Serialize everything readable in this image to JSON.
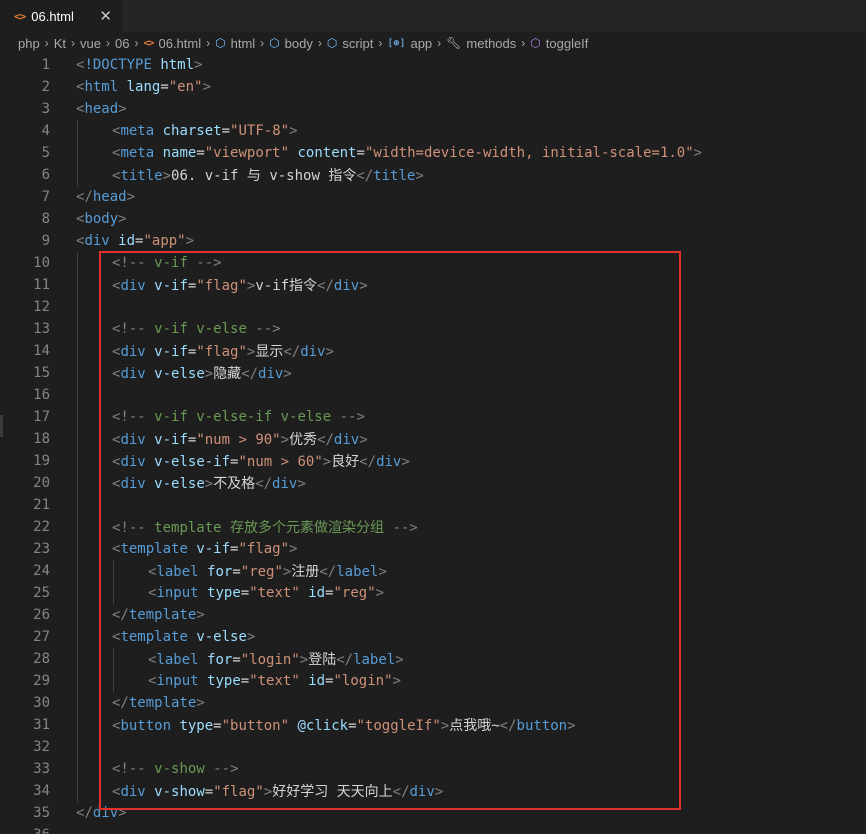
{
  "tab": {
    "icon": "<>",
    "label": "06.html",
    "close": "✕"
  },
  "breadcrumb": [
    {
      "label": "php",
      "icon": ""
    },
    {
      "label": "Kt",
      "icon": ""
    },
    {
      "label": "vue",
      "icon": ""
    },
    {
      "label": "06",
      "icon": ""
    },
    {
      "label": "06.html",
      "icon": "html-file-icon"
    },
    {
      "label": "html",
      "icon": "element-icon"
    },
    {
      "label": "body",
      "icon": "element-icon"
    },
    {
      "label": "script",
      "icon": "element-icon"
    },
    {
      "label": "app",
      "icon": "variable-icon"
    },
    {
      "label": "methods",
      "icon": "wrench-icon"
    },
    {
      "label": "toggleIf",
      "icon": "method-icon"
    }
  ],
  "lines": [
    {
      "n": "1",
      "indent": 0,
      "tokens": [
        [
          "t",
          "<"
        ],
        [
          "tag",
          "!DOCTYPE"
        ],
        [
          "t",
          " "
        ],
        [
          "attr",
          "html"
        ],
        [
          "t",
          ">"
        ]
      ]
    },
    {
      "n": "2",
      "indent": 0,
      "tokens": [
        [
          "t",
          "<"
        ],
        [
          "tag",
          "html"
        ],
        [
          "t",
          " "
        ],
        [
          "attr",
          "lang"
        ],
        [
          "txt",
          "="
        ],
        [
          "val",
          "\"en\""
        ],
        [
          "t",
          ">"
        ]
      ]
    },
    {
      "n": "3",
      "indent": 0,
      "tokens": [
        [
          "t",
          "<"
        ],
        [
          "tag",
          "head"
        ],
        [
          "t",
          ">"
        ]
      ]
    },
    {
      "n": "4",
      "indent": 1,
      "tokens": [
        [
          "t",
          "<"
        ],
        [
          "tag",
          "meta"
        ],
        [
          "t",
          " "
        ],
        [
          "attr",
          "charset"
        ],
        [
          "txt",
          "="
        ],
        [
          "val",
          "\"UTF-8\""
        ],
        [
          "t",
          ">"
        ]
      ]
    },
    {
      "n": "5",
      "indent": 1,
      "tokens": [
        [
          "t",
          "<"
        ],
        [
          "tag",
          "meta"
        ],
        [
          "t",
          " "
        ],
        [
          "attr",
          "name"
        ],
        [
          "txt",
          "="
        ],
        [
          "val",
          "\"viewport\""
        ],
        [
          "t",
          " "
        ],
        [
          "attr",
          "content"
        ],
        [
          "txt",
          "="
        ],
        [
          "val",
          "\"width=device-width, initial-scale=1.0\""
        ],
        [
          "t",
          ">"
        ]
      ]
    },
    {
      "n": "6",
      "indent": 1,
      "tokens": [
        [
          "t",
          "<"
        ],
        [
          "tag",
          "title"
        ],
        [
          "t",
          ">"
        ],
        [
          "txt",
          "06. v-if 与 v-show 指令"
        ],
        [
          "t",
          "</"
        ],
        [
          "tag",
          "title"
        ],
        [
          "t",
          ">"
        ]
      ]
    },
    {
      "n": "7",
      "indent": 0,
      "tokens": [
        [
          "t",
          "</"
        ],
        [
          "tag",
          "head"
        ],
        [
          "t",
          ">"
        ]
      ]
    },
    {
      "n": "8",
      "indent": 0,
      "tokens": [
        [
          "t",
          "<"
        ],
        [
          "tag",
          "body"
        ],
        [
          "t",
          ">"
        ]
      ]
    },
    {
      "n": "9",
      "indent": 0,
      "tokens": [
        [
          "t",
          "<"
        ],
        [
          "tag",
          "div"
        ],
        [
          "t",
          " "
        ],
        [
          "attr",
          "id"
        ],
        [
          "txt",
          "="
        ],
        [
          "val",
          "\"app\""
        ],
        [
          "t",
          ">"
        ]
      ]
    },
    {
      "n": "10",
      "indent": 1,
      "tokens": [
        [
          "t",
          "<!-- "
        ],
        [
          "cmt",
          "v-if"
        ],
        [
          "t",
          " -->"
        ]
      ]
    },
    {
      "n": "11",
      "indent": 1,
      "tokens": [
        [
          "t",
          "<"
        ],
        [
          "tag",
          "div"
        ],
        [
          "t",
          " "
        ],
        [
          "attr",
          "v-if"
        ],
        [
          "txt",
          "="
        ],
        [
          "val",
          "\"flag\""
        ],
        [
          "t",
          ">"
        ],
        [
          "txt",
          "v-if指令"
        ],
        [
          "t",
          "</"
        ],
        [
          "tag",
          "div"
        ],
        [
          "t",
          ">"
        ]
      ]
    },
    {
      "n": "12",
      "indent": 1,
      "tokens": []
    },
    {
      "n": "13",
      "indent": 1,
      "tokens": [
        [
          "t",
          "<!-- "
        ],
        [
          "cmt",
          "v-if v-else"
        ],
        [
          "t",
          " -->"
        ]
      ]
    },
    {
      "n": "14",
      "indent": 1,
      "tokens": [
        [
          "t",
          "<"
        ],
        [
          "tag",
          "div"
        ],
        [
          "t",
          " "
        ],
        [
          "attr",
          "v-if"
        ],
        [
          "txt",
          "="
        ],
        [
          "val",
          "\"flag\""
        ],
        [
          "t",
          ">"
        ],
        [
          "txt",
          "显示"
        ],
        [
          "t",
          "</"
        ],
        [
          "tag",
          "div"
        ],
        [
          "t",
          ">"
        ]
      ]
    },
    {
      "n": "15",
      "indent": 1,
      "tokens": [
        [
          "t",
          "<"
        ],
        [
          "tag",
          "div"
        ],
        [
          "t",
          " "
        ],
        [
          "attr",
          "v-else"
        ],
        [
          "t",
          ">"
        ],
        [
          "txt",
          "隐藏"
        ],
        [
          "t",
          "</"
        ],
        [
          "tag",
          "div"
        ],
        [
          "t",
          ">"
        ]
      ]
    },
    {
      "n": "16",
      "indent": 1,
      "tokens": []
    },
    {
      "n": "17",
      "indent": 1,
      "tokens": [
        [
          "t",
          "<!-- "
        ],
        [
          "cmt",
          "v-if v-else-if v-else"
        ],
        [
          "t",
          " -->"
        ]
      ]
    },
    {
      "n": "18",
      "indent": 1,
      "tokens": [
        [
          "t",
          "<"
        ],
        [
          "tag",
          "div"
        ],
        [
          "t",
          " "
        ],
        [
          "attr",
          "v-if"
        ],
        [
          "txt",
          "="
        ],
        [
          "val",
          "\"num > 90\""
        ],
        [
          "t",
          ">"
        ],
        [
          "txt",
          "优秀"
        ],
        [
          "t",
          "</"
        ],
        [
          "tag",
          "div"
        ],
        [
          "t",
          ">"
        ]
      ]
    },
    {
      "n": "19",
      "indent": 1,
      "tokens": [
        [
          "t",
          "<"
        ],
        [
          "tag",
          "div"
        ],
        [
          "t",
          " "
        ],
        [
          "attr",
          "v-else-if"
        ],
        [
          "txt",
          "="
        ],
        [
          "val",
          "\"num > 60\""
        ],
        [
          "t",
          ">"
        ],
        [
          "txt",
          "良好"
        ],
        [
          "t",
          "</"
        ],
        [
          "tag",
          "div"
        ],
        [
          "t",
          ">"
        ]
      ]
    },
    {
      "n": "20",
      "indent": 1,
      "tokens": [
        [
          "t",
          "<"
        ],
        [
          "tag",
          "div"
        ],
        [
          "t",
          " "
        ],
        [
          "attr",
          "v-else"
        ],
        [
          "t",
          ">"
        ],
        [
          "txt",
          "不及格"
        ],
        [
          "t",
          "</"
        ],
        [
          "tag",
          "div"
        ],
        [
          "t",
          ">"
        ]
      ]
    },
    {
      "n": "21",
      "indent": 1,
      "tokens": []
    },
    {
      "n": "22",
      "indent": 1,
      "tokens": [
        [
          "t",
          "<!-- "
        ],
        [
          "cmt",
          "template 存放多个元素做渲染分组"
        ],
        [
          "t",
          " -->"
        ]
      ]
    },
    {
      "n": "23",
      "indent": 1,
      "tokens": [
        [
          "t",
          "<"
        ],
        [
          "tag",
          "template"
        ],
        [
          "t",
          " "
        ],
        [
          "attr",
          "v-if"
        ],
        [
          "txt",
          "="
        ],
        [
          "val",
          "\"flag\""
        ],
        [
          "t",
          ">"
        ]
      ]
    },
    {
      "n": "24",
      "indent": 2,
      "tokens": [
        [
          "t",
          "<"
        ],
        [
          "tag",
          "label"
        ],
        [
          "t",
          " "
        ],
        [
          "attr",
          "for"
        ],
        [
          "txt",
          "="
        ],
        [
          "val",
          "\"reg\""
        ],
        [
          "t",
          ">"
        ],
        [
          "txt",
          "注册"
        ],
        [
          "t",
          "</"
        ],
        [
          "tag",
          "label"
        ],
        [
          "t",
          ">"
        ]
      ]
    },
    {
      "n": "25",
      "indent": 2,
      "tokens": [
        [
          "t",
          "<"
        ],
        [
          "tag",
          "input"
        ],
        [
          "t",
          " "
        ],
        [
          "attr",
          "type"
        ],
        [
          "txt",
          "="
        ],
        [
          "val",
          "\"text\""
        ],
        [
          "t",
          " "
        ],
        [
          "attr",
          "id"
        ],
        [
          "txt",
          "="
        ],
        [
          "val",
          "\"reg\""
        ],
        [
          "t",
          ">"
        ]
      ]
    },
    {
      "n": "26",
      "indent": 1,
      "tokens": [
        [
          "t",
          "</"
        ],
        [
          "tag",
          "template"
        ],
        [
          "t",
          ">"
        ]
      ]
    },
    {
      "n": "27",
      "indent": 1,
      "tokens": [
        [
          "t",
          "<"
        ],
        [
          "tag",
          "template"
        ],
        [
          "t",
          " "
        ],
        [
          "attr",
          "v-else"
        ],
        [
          "t",
          ">"
        ]
      ]
    },
    {
      "n": "28",
      "indent": 2,
      "tokens": [
        [
          "t",
          "<"
        ],
        [
          "tag",
          "label"
        ],
        [
          "t",
          " "
        ],
        [
          "attr",
          "for"
        ],
        [
          "txt",
          "="
        ],
        [
          "val",
          "\"login\""
        ],
        [
          "t",
          ">"
        ],
        [
          "txt",
          "登陆"
        ],
        [
          "t",
          "</"
        ],
        [
          "tag",
          "label"
        ],
        [
          "t",
          ">"
        ]
      ]
    },
    {
      "n": "29",
      "indent": 2,
      "tokens": [
        [
          "t",
          "<"
        ],
        [
          "tag",
          "input"
        ],
        [
          "t",
          " "
        ],
        [
          "attr",
          "type"
        ],
        [
          "txt",
          "="
        ],
        [
          "val",
          "\"text\""
        ],
        [
          "t",
          " "
        ],
        [
          "attr",
          "id"
        ],
        [
          "txt",
          "="
        ],
        [
          "val",
          "\"login\""
        ],
        [
          "t",
          ">"
        ]
      ]
    },
    {
      "n": "30",
      "indent": 1,
      "tokens": [
        [
          "t",
          "</"
        ],
        [
          "tag",
          "template"
        ],
        [
          "t",
          ">"
        ]
      ]
    },
    {
      "n": "31",
      "indent": 1,
      "tokens": [
        [
          "t",
          "<"
        ],
        [
          "tag",
          "button"
        ],
        [
          "t",
          " "
        ],
        [
          "attr",
          "type"
        ],
        [
          "txt",
          "="
        ],
        [
          "val",
          "\"button\""
        ],
        [
          "t",
          " "
        ],
        [
          "attr",
          "@click"
        ],
        [
          "txt",
          "="
        ],
        [
          "val",
          "\"toggleIf\""
        ],
        [
          "t",
          ">"
        ],
        [
          "txt",
          "点我哦~"
        ],
        [
          "t",
          "</"
        ],
        [
          "tag",
          "button"
        ],
        [
          "t",
          ">"
        ]
      ]
    },
    {
      "n": "32",
      "indent": 1,
      "tokens": []
    },
    {
      "n": "33",
      "indent": 1,
      "tokens": [
        [
          "t",
          "<!-- "
        ],
        [
          "cmt",
          "v-show"
        ],
        [
          "t",
          " -->"
        ]
      ]
    },
    {
      "n": "34",
      "indent": 1,
      "tokens": [
        [
          "t",
          "<"
        ],
        [
          "tag",
          "div"
        ],
        [
          "t",
          " "
        ],
        [
          "attr",
          "v-show"
        ],
        [
          "txt",
          "="
        ],
        [
          "val",
          "\"flag\""
        ],
        [
          "t",
          ">"
        ],
        [
          "txt",
          "好好学习 天天向上"
        ],
        [
          "t",
          "</"
        ],
        [
          "tag",
          "div"
        ],
        [
          "t",
          ">"
        ]
      ]
    },
    {
      "n": "35",
      "indent": 0,
      "tokens": [
        [
          "t",
          "</"
        ],
        [
          "tag",
          "div"
        ],
        [
          "t",
          ">"
        ]
      ]
    },
    {
      "n": "36",
      "indent": 0,
      "tokens": []
    }
  ],
  "colors": {
    "tag": "#569cd6",
    "attr": "#9cdcfe",
    "value": "#ce9178",
    "comment": "#6a9955",
    "punct": "#808080",
    "highlight_box": "#e0312f"
  }
}
